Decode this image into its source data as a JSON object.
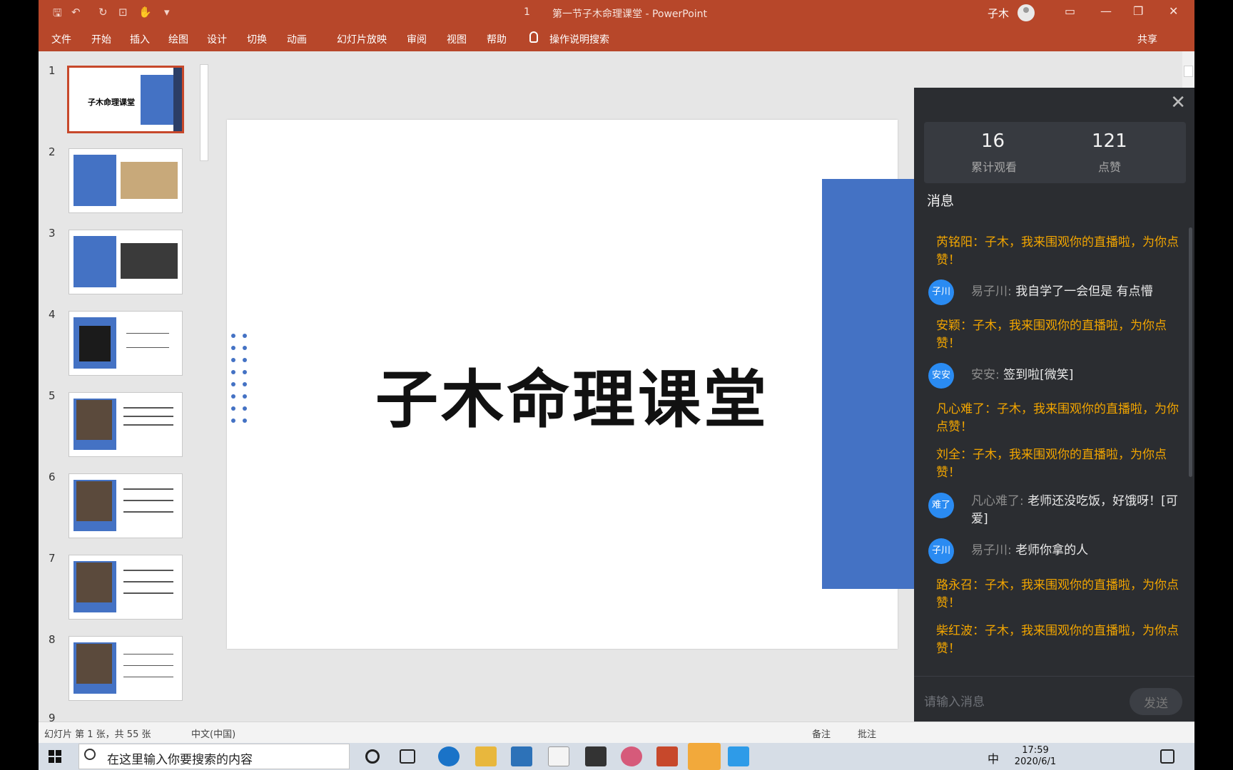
{
  "titlebar": {
    "slide_indicator": "1",
    "doc_title": "第一节子木命理课堂 - PowerPoint",
    "user_name": "子木"
  },
  "ribbon": {
    "tabs": [
      "文件",
      "开始",
      "插入",
      "绘图",
      "设计",
      "切换",
      "动画",
      "幻灯片放映",
      "审阅",
      "视图",
      "帮助"
    ],
    "tell_me": "操作说明搜索",
    "share": "共享"
  },
  "slide_panel": {
    "numbers": [
      "1",
      "2",
      "3",
      "4",
      "5",
      "6",
      "7",
      "8",
      "9"
    ],
    "thumb1_title": "子木命理课堂"
  },
  "slide": {
    "title": "子木命理课堂",
    "accent_color": "#4472c4"
  },
  "live": {
    "viewers": "16",
    "viewers_label": "累计观看",
    "likes": "121",
    "likes_label": "点赞",
    "messages_title": "消息",
    "messages": [
      {
        "type": "system",
        "text": "芮铭阳：子木，我来围观你的直播啦，为你点赞！"
      },
      {
        "type": "user",
        "avatar": "子川",
        "name": "易子川:",
        "text": "我自学了一会但是 有点懵"
      },
      {
        "type": "system",
        "text": "安颖：子木，我来围观你的直播啦，为你点赞！"
      },
      {
        "type": "user",
        "avatar": "安安",
        "name": "安安:",
        "text": "签到啦[微笑]"
      },
      {
        "type": "system",
        "text": "凡心难了：子木，我来围观你的直播啦，为你点赞！"
      },
      {
        "type": "system",
        "text": "刘全：子木，我来围观你的直播啦，为你点赞！"
      },
      {
        "type": "user",
        "avatar": "难了",
        "name": "凡心难了:",
        "text": "老师还没吃饭，好饿呀！[可爱]"
      },
      {
        "type": "user",
        "avatar": "子川",
        "name": "易子川:",
        "text": "老师你拿的人"
      },
      {
        "type": "system",
        "text": "路永召：子木，我来围观你的直播啦，为你点赞！"
      },
      {
        "type": "system",
        "text": "柴红波：子木，我来围观你的直播啦，为你点赞！"
      }
    ],
    "input_placeholder": "请输入消息",
    "send_label": "发送"
  },
  "statusbar": {
    "slide_info": "幻灯片 第 1 张，共 55 张",
    "language": "中文(中国)",
    "notes": "备注",
    "comments": "批注"
  },
  "taskbar": {
    "search_text": "在这里输入你要搜索的内容",
    "ime": "中",
    "time": "17:59",
    "date": "2020/6/1"
  }
}
